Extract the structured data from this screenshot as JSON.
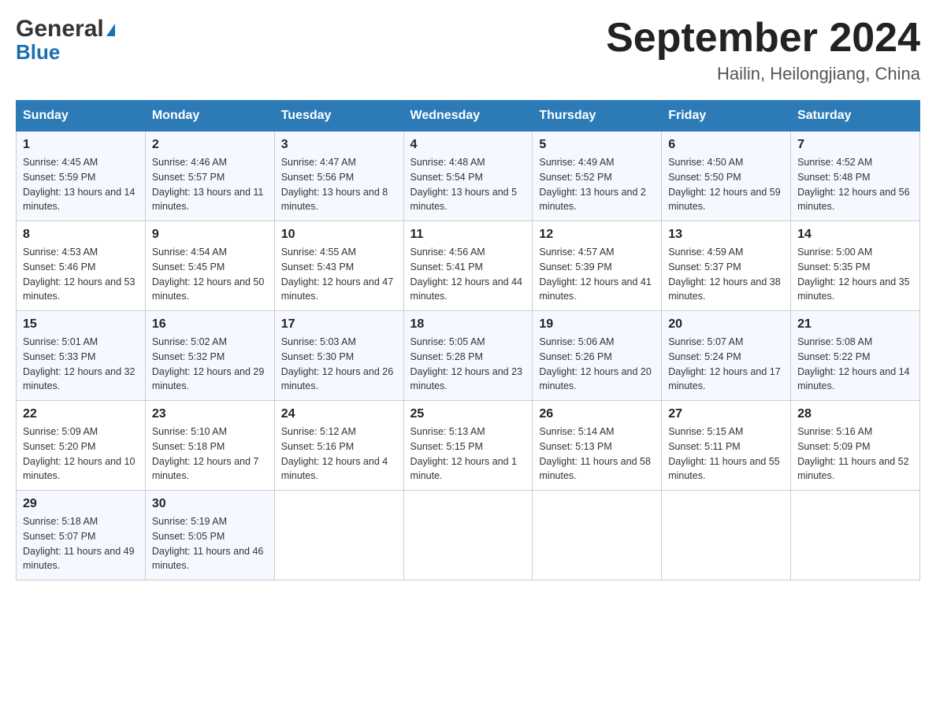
{
  "header": {
    "logo_general": "General",
    "logo_blue": "Blue",
    "title": "September 2024",
    "subtitle": "Hailin, Heilongjiang, China"
  },
  "days_of_week": [
    "Sunday",
    "Monday",
    "Tuesday",
    "Wednesday",
    "Thursday",
    "Friday",
    "Saturday"
  ],
  "weeks": [
    [
      {
        "day": "1",
        "sunrise": "4:45 AM",
        "sunset": "5:59 PM",
        "daylight": "13 hours and 14 minutes."
      },
      {
        "day": "2",
        "sunrise": "4:46 AM",
        "sunset": "5:57 PM",
        "daylight": "13 hours and 11 minutes."
      },
      {
        "day": "3",
        "sunrise": "4:47 AM",
        "sunset": "5:56 PM",
        "daylight": "13 hours and 8 minutes."
      },
      {
        "day": "4",
        "sunrise": "4:48 AM",
        "sunset": "5:54 PM",
        "daylight": "13 hours and 5 minutes."
      },
      {
        "day": "5",
        "sunrise": "4:49 AM",
        "sunset": "5:52 PM",
        "daylight": "13 hours and 2 minutes."
      },
      {
        "day": "6",
        "sunrise": "4:50 AM",
        "sunset": "5:50 PM",
        "daylight": "12 hours and 59 minutes."
      },
      {
        "day": "7",
        "sunrise": "4:52 AM",
        "sunset": "5:48 PM",
        "daylight": "12 hours and 56 minutes."
      }
    ],
    [
      {
        "day": "8",
        "sunrise": "4:53 AM",
        "sunset": "5:46 PM",
        "daylight": "12 hours and 53 minutes."
      },
      {
        "day": "9",
        "sunrise": "4:54 AM",
        "sunset": "5:45 PM",
        "daylight": "12 hours and 50 minutes."
      },
      {
        "day": "10",
        "sunrise": "4:55 AM",
        "sunset": "5:43 PM",
        "daylight": "12 hours and 47 minutes."
      },
      {
        "day": "11",
        "sunrise": "4:56 AM",
        "sunset": "5:41 PM",
        "daylight": "12 hours and 44 minutes."
      },
      {
        "day": "12",
        "sunrise": "4:57 AM",
        "sunset": "5:39 PM",
        "daylight": "12 hours and 41 minutes."
      },
      {
        "day": "13",
        "sunrise": "4:59 AM",
        "sunset": "5:37 PM",
        "daylight": "12 hours and 38 minutes."
      },
      {
        "day": "14",
        "sunrise": "5:00 AM",
        "sunset": "5:35 PM",
        "daylight": "12 hours and 35 minutes."
      }
    ],
    [
      {
        "day": "15",
        "sunrise": "5:01 AM",
        "sunset": "5:33 PM",
        "daylight": "12 hours and 32 minutes."
      },
      {
        "day": "16",
        "sunrise": "5:02 AM",
        "sunset": "5:32 PM",
        "daylight": "12 hours and 29 minutes."
      },
      {
        "day": "17",
        "sunrise": "5:03 AM",
        "sunset": "5:30 PM",
        "daylight": "12 hours and 26 minutes."
      },
      {
        "day": "18",
        "sunrise": "5:05 AM",
        "sunset": "5:28 PM",
        "daylight": "12 hours and 23 minutes."
      },
      {
        "day": "19",
        "sunrise": "5:06 AM",
        "sunset": "5:26 PM",
        "daylight": "12 hours and 20 minutes."
      },
      {
        "day": "20",
        "sunrise": "5:07 AM",
        "sunset": "5:24 PM",
        "daylight": "12 hours and 17 minutes."
      },
      {
        "day": "21",
        "sunrise": "5:08 AM",
        "sunset": "5:22 PM",
        "daylight": "12 hours and 14 minutes."
      }
    ],
    [
      {
        "day": "22",
        "sunrise": "5:09 AM",
        "sunset": "5:20 PM",
        "daylight": "12 hours and 10 minutes."
      },
      {
        "day": "23",
        "sunrise": "5:10 AM",
        "sunset": "5:18 PM",
        "daylight": "12 hours and 7 minutes."
      },
      {
        "day": "24",
        "sunrise": "5:12 AM",
        "sunset": "5:16 PM",
        "daylight": "12 hours and 4 minutes."
      },
      {
        "day": "25",
        "sunrise": "5:13 AM",
        "sunset": "5:15 PM",
        "daylight": "12 hours and 1 minute."
      },
      {
        "day": "26",
        "sunrise": "5:14 AM",
        "sunset": "5:13 PM",
        "daylight": "11 hours and 58 minutes."
      },
      {
        "day": "27",
        "sunrise": "5:15 AM",
        "sunset": "5:11 PM",
        "daylight": "11 hours and 55 minutes."
      },
      {
        "day": "28",
        "sunrise": "5:16 AM",
        "sunset": "5:09 PM",
        "daylight": "11 hours and 52 minutes."
      }
    ],
    [
      {
        "day": "29",
        "sunrise": "5:18 AM",
        "sunset": "5:07 PM",
        "daylight": "11 hours and 49 minutes."
      },
      {
        "day": "30",
        "sunrise": "5:19 AM",
        "sunset": "5:05 PM",
        "daylight": "11 hours and 46 minutes."
      },
      null,
      null,
      null,
      null,
      null
    ]
  ]
}
